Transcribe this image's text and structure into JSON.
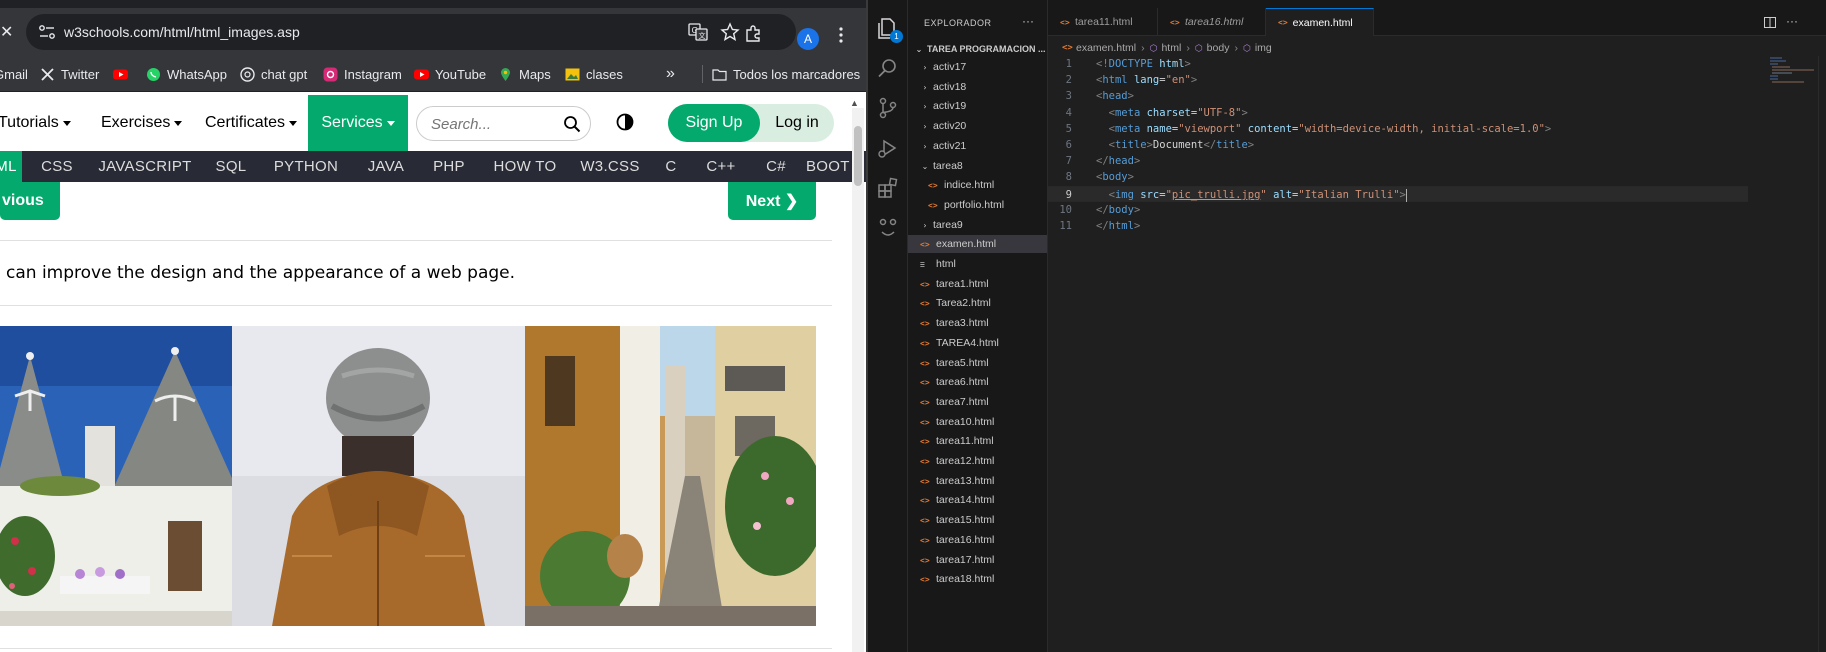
{
  "browser": {
    "url": "w3schools.com/html/html_images.asp",
    "profile_initial": "A",
    "bookmarks": [
      {
        "label": "Gmail",
        "icon": "gmail-icon"
      },
      {
        "label": "Twitter",
        "icon": "x-twitter-icon"
      },
      {
        "label": "",
        "icon": "youtube-icon"
      },
      {
        "label": "WhatsApp",
        "icon": "whatsapp-icon"
      },
      {
        "label": "chat gpt",
        "icon": "openai-icon"
      },
      {
        "label": "Instagram",
        "icon": "instagram-icon"
      },
      {
        "label": "YouTube",
        "icon": "youtube-icon"
      },
      {
        "label": "Maps",
        "icon": "maps-pin-icon"
      },
      {
        "label": "clases",
        "icon": "folder-image-icon"
      }
    ],
    "bookmarks_overflow": "»",
    "all_bookmarks": "Todos los marcadores"
  },
  "w3": {
    "nav": {
      "tutorials": "Tutorials",
      "exercises": "Exercises",
      "certificates": "Certificates",
      "services": "Services",
      "search_placeholder": "Search...",
      "signup": "Sign Up",
      "login": "Log in"
    },
    "topics": [
      "ML",
      "CSS",
      "JAVASCRIPT",
      "SQL",
      "PYTHON",
      "JAVA",
      "PHP",
      "HOW TO",
      "W3.CSS",
      "C",
      "C++",
      "C#",
      "BOOT"
    ],
    "prev_label": "vious",
    "next_label": "Next ❯",
    "intro": "can improve the design and the appearance of a web page.",
    "accent": "#04aa6d"
  },
  "vscode": {
    "explorer_title": "EXPLORADOR",
    "workspace": "TAREA PROGRAMACION ...",
    "activity_badge": "1",
    "tree": [
      {
        "label": "activ17",
        "kind": "folder",
        "chev": "›"
      },
      {
        "label": "activ18",
        "kind": "folder",
        "chev": "›"
      },
      {
        "label": "activ19",
        "kind": "folder",
        "chev": "›"
      },
      {
        "label": "activ20",
        "kind": "folder",
        "chev": "›"
      },
      {
        "label": "activ21",
        "kind": "folder",
        "chev": "›"
      },
      {
        "label": "tarea8",
        "kind": "folder",
        "chev": "⌄"
      },
      {
        "label": "indice.html",
        "kind": "html",
        "indent": 1
      },
      {
        "label": "portfolio.html",
        "kind": "html",
        "indent": 1
      },
      {
        "label": "tarea9",
        "kind": "folder",
        "chev": "›"
      },
      {
        "label": "examen.html",
        "kind": "html",
        "selected": true
      },
      {
        "label": "html",
        "kind": "plain"
      },
      {
        "label": "tarea1.html",
        "kind": "html"
      },
      {
        "label": "Tarea2.html",
        "kind": "html"
      },
      {
        "label": "tarea3.html",
        "kind": "html"
      },
      {
        "label": "TAREA4.html",
        "kind": "html"
      },
      {
        "label": "tarea5.html",
        "kind": "html"
      },
      {
        "label": "tarea6.html",
        "kind": "html"
      },
      {
        "label": "tarea7.html",
        "kind": "html"
      },
      {
        "label": "tarea10.html",
        "kind": "html"
      },
      {
        "label": "tarea11.html",
        "kind": "html"
      },
      {
        "label": "tarea12.html",
        "kind": "html"
      },
      {
        "label": "tarea13.html",
        "kind": "html"
      },
      {
        "label": "tarea14.html",
        "kind": "html"
      },
      {
        "label": "tarea15.html",
        "kind": "html"
      },
      {
        "label": "tarea16.html",
        "kind": "html"
      },
      {
        "label": "tarea17.html",
        "kind": "html"
      },
      {
        "label": "tarea18.html",
        "kind": "html"
      }
    ],
    "tabs": [
      {
        "label": "tarea11.html",
        "active": false,
        "italic": false
      },
      {
        "label": "tarea16.html",
        "active": false,
        "italic": true
      },
      {
        "label": "examen.html",
        "active": true,
        "dirty": true
      }
    ],
    "breadcrumbs": [
      "examen.html",
      "html",
      "body",
      "img"
    ],
    "current_line": 9,
    "code": [
      [
        {
          "t": "brk",
          "v": "<!"
        },
        {
          "t": "tag",
          "v": "DOCTYPE"
        },
        {
          "t": "txt",
          "v": " "
        },
        {
          "t": "attr",
          "v": "html"
        },
        {
          "t": "brk",
          "v": ">"
        }
      ],
      [
        {
          "t": "brk",
          "v": "<"
        },
        {
          "t": "tag",
          "v": "html"
        },
        {
          "t": "txt",
          "v": " "
        },
        {
          "t": "attr",
          "v": "lang"
        },
        {
          "t": "txt",
          "v": "="
        },
        {
          "t": "str",
          "v": "\"en\""
        },
        {
          "t": "brk",
          "v": ">"
        }
      ],
      [
        {
          "t": "brk",
          "v": "<"
        },
        {
          "t": "tag",
          "v": "head"
        },
        {
          "t": "brk",
          "v": ">"
        }
      ],
      [
        {
          "t": "txt",
          "v": "  "
        },
        {
          "t": "brk",
          "v": "<"
        },
        {
          "t": "tag",
          "v": "meta"
        },
        {
          "t": "txt",
          "v": " "
        },
        {
          "t": "attr",
          "v": "charset"
        },
        {
          "t": "txt",
          "v": "="
        },
        {
          "t": "str",
          "v": "\"UTF-8\""
        },
        {
          "t": "brk",
          "v": ">"
        }
      ],
      [
        {
          "t": "txt",
          "v": "  "
        },
        {
          "t": "brk",
          "v": "<"
        },
        {
          "t": "tag",
          "v": "meta"
        },
        {
          "t": "txt",
          "v": " "
        },
        {
          "t": "attr",
          "v": "name"
        },
        {
          "t": "txt",
          "v": "="
        },
        {
          "t": "str",
          "v": "\"viewport\""
        },
        {
          "t": "txt",
          "v": " "
        },
        {
          "t": "attr",
          "v": "content"
        },
        {
          "t": "txt",
          "v": "="
        },
        {
          "t": "str",
          "v": "\"width=device-width, initial-scale=1.0\""
        },
        {
          "t": "brk",
          "v": ">"
        }
      ],
      [
        {
          "t": "txt",
          "v": "  "
        },
        {
          "t": "brk",
          "v": "<"
        },
        {
          "t": "tag",
          "v": "title"
        },
        {
          "t": "brk",
          "v": ">"
        },
        {
          "t": "txt",
          "v": "Document"
        },
        {
          "t": "brk",
          "v": "</"
        },
        {
          "t": "tag",
          "v": "title"
        },
        {
          "t": "brk",
          "v": ">"
        }
      ],
      [
        {
          "t": "brk",
          "v": "</"
        },
        {
          "t": "tag",
          "v": "head"
        },
        {
          "t": "brk",
          "v": ">"
        }
      ],
      [
        {
          "t": "brk",
          "v": "<"
        },
        {
          "t": "tag",
          "v": "body"
        },
        {
          "t": "brk",
          "v": ">"
        }
      ],
      [
        {
          "t": "txt",
          "v": "  "
        },
        {
          "t": "brk",
          "v": "<"
        },
        {
          "t": "tag",
          "v": "img"
        },
        {
          "t": "txt",
          "v": " "
        },
        {
          "t": "attr",
          "v": "src"
        },
        {
          "t": "txt",
          "v": "="
        },
        {
          "t": "str",
          "v": "\""
        },
        {
          "t": "url",
          "v": "pic_trulli.jpg"
        },
        {
          "t": "str",
          "v": "\""
        },
        {
          "t": "txt",
          "v": " "
        },
        {
          "t": "attr",
          "v": "alt"
        },
        {
          "t": "txt",
          "v": "="
        },
        {
          "t": "str",
          "v": "\"Italian Trulli\""
        },
        {
          "t": "brk",
          "v": ">"
        }
      ],
      [
        {
          "t": "brk",
          "v": "</"
        },
        {
          "t": "tag",
          "v": "body"
        },
        {
          "t": "brk",
          "v": ">"
        }
      ],
      [
        {
          "t": "brk",
          "v": "</"
        },
        {
          "t": "tag",
          "v": "html"
        },
        {
          "t": "brk",
          "v": ">"
        }
      ]
    ]
  }
}
